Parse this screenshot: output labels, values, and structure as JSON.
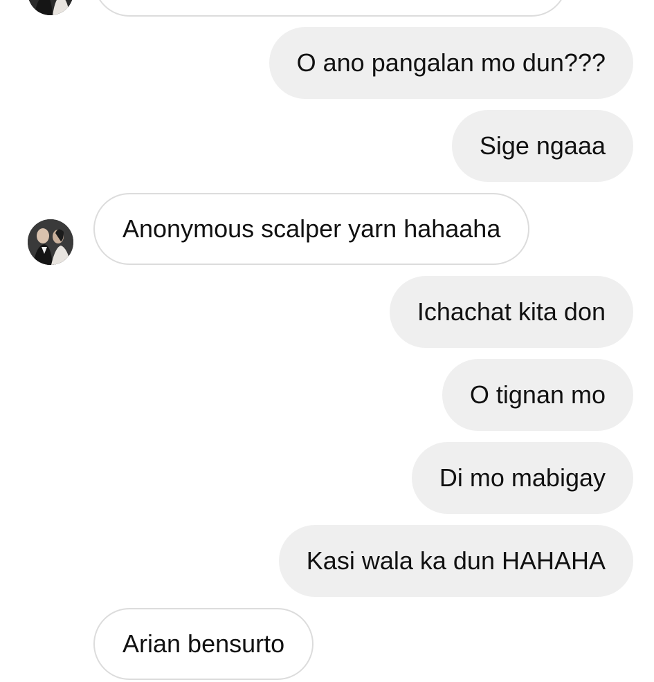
{
  "thread": {
    "messages": [
      {
        "id": "m0",
        "direction": "incoming",
        "text": "",
        "cropped": true
      },
      {
        "id": "m1",
        "direction": "outgoing",
        "text": "O ano pangalan mo dun???"
      },
      {
        "id": "m2",
        "direction": "outgoing",
        "text": "Sige ngaaa"
      },
      {
        "id": "m3",
        "direction": "incoming",
        "text": "Anonymous scalper yarn hahaaha"
      },
      {
        "id": "m4",
        "direction": "outgoing",
        "text": "Ichachat kita don"
      },
      {
        "id": "m5",
        "direction": "outgoing",
        "text": "O tignan mo"
      },
      {
        "id": "m6",
        "direction": "outgoing",
        "text": "Di mo mabigay"
      },
      {
        "id": "m7",
        "direction": "outgoing",
        "text": "Kasi wala ka dun HAHAHA"
      },
      {
        "id": "m8",
        "direction": "incoming",
        "text": "Arian bensurto"
      }
    ]
  },
  "avatar": {
    "icon": "contact-avatar-photo"
  },
  "colors": {
    "outgoing_bubble": "#efefef",
    "incoming_bubble": "#ffffff",
    "incoming_border": "#dcdcdc",
    "text": "#111111"
  }
}
